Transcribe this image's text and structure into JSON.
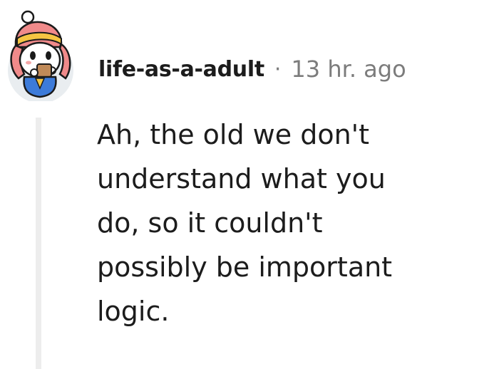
{
  "comment": {
    "author": "life-as-a-adult",
    "separator": "·",
    "timestamp": "13 hr. ago",
    "body_lines": [
      "Ah, the old we don't",
      "understand what you",
      "do, so it couldn't",
      "possibly be important",
      "logic."
    ]
  }
}
